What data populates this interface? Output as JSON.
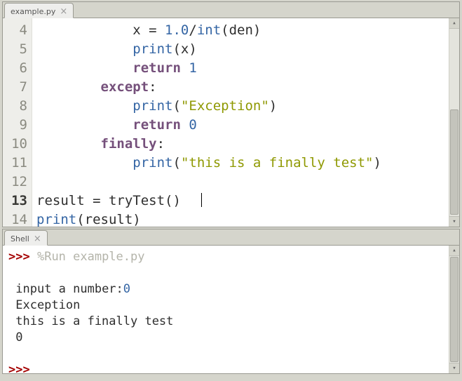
{
  "editor": {
    "tab_label": "example.py",
    "first_line_no": 4,
    "current_line_no": 13,
    "lines": [
      {
        "indent": "            ",
        "tokens": [
          {
            "t": "x = ",
            "c": ""
          },
          {
            "t": "1.0",
            "c": "num"
          },
          {
            "t": "/",
            "c": ""
          },
          {
            "t": "int",
            "c": "fn"
          },
          {
            "t": "(den)",
            "c": ""
          }
        ]
      },
      {
        "indent": "            ",
        "tokens": [
          {
            "t": "print",
            "c": "fn"
          },
          {
            "t": "(x)",
            "c": ""
          }
        ]
      },
      {
        "indent": "            ",
        "tokens": [
          {
            "t": "return",
            "c": "kw"
          },
          {
            "t": " ",
            "c": ""
          },
          {
            "t": "1",
            "c": "num"
          }
        ]
      },
      {
        "indent": "        ",
        "tokens": [
          {
            "t": "except",
            "c": "kw"
          },
          {
            "t": ":",
            "c": ""
          }
        ]
      },
      {
        "indent": "            ",
        "tokens": [
          {
            "t": "print",
            "c": "fn"
          },
          {
            "t": "(",
            "c": ""
          },
          {
            "t": "\"Exception\"",
            "c": "str"
          },
          {
            "t": ")",
            "c": ""
          }
        ]
      },
      {
        "indent": "            ",
        "tokens": [
          {
            "t": "return",
            "c": "kw"
          },
          {
            "t": " ",
            "c": ""
          },
          {
            "t": "0",
            "c": "num"
          }
        ]
      },
      {
        "indent": "        ",
        "tokens": [
          {
            "t": "finally",
            "c": "kw"
          },
          {
            "t": ":",
            "c": ""
          }
        ]
      },
      {
        "indent": "            ",
        "tokens": [
          {
            "t": "print",
            "c": "fn"
          },
          {
            "t": "(",
            "c": ""
          },
          {
            "t": "\"this is a finally test\"",
            "c": "str"
          },
          {
            "t": ")",
            "c": ""
          }
        ]
      },
      {
        "indent": "",
        "tokens": []
      },
      {
        "indent": "",
        "tokens": [
          {
            "t": "result = tryTest()  ",
            "c": ""
          }
        ],
        "cursor_after": true
      },
      {
        "indent": "",
        "tokens": [
          {
            "t": "print",
            "c": "fn"
          },
          {
            "t": "(result)",
            "c": ""
          }
        ]
      }
    ]
  },
  "shell": {
    "tab_label": "Shell",
    "prompt": ">>>",
    "run_cmd": "%Run example.py",
    "output_lines": [
      {
        "segments": [
          {
            "t": "input a number:",
            "c": "inputlabel"
          },
          {
            "t": "0",
            "c": "num"
          }
        ]
      },
      {
        "segments": [
          {
            "t": "Exception",
            "c": ""
          }
        ]
      },
      {
        "segments": [
          {
            "t": "this is a finally test",
            "c": ""
          }
        ]
      },
      {
        "segments": [
          {
            "t": "0",
            "c": ""
          }
        ]
      }
    ]
  }
}
